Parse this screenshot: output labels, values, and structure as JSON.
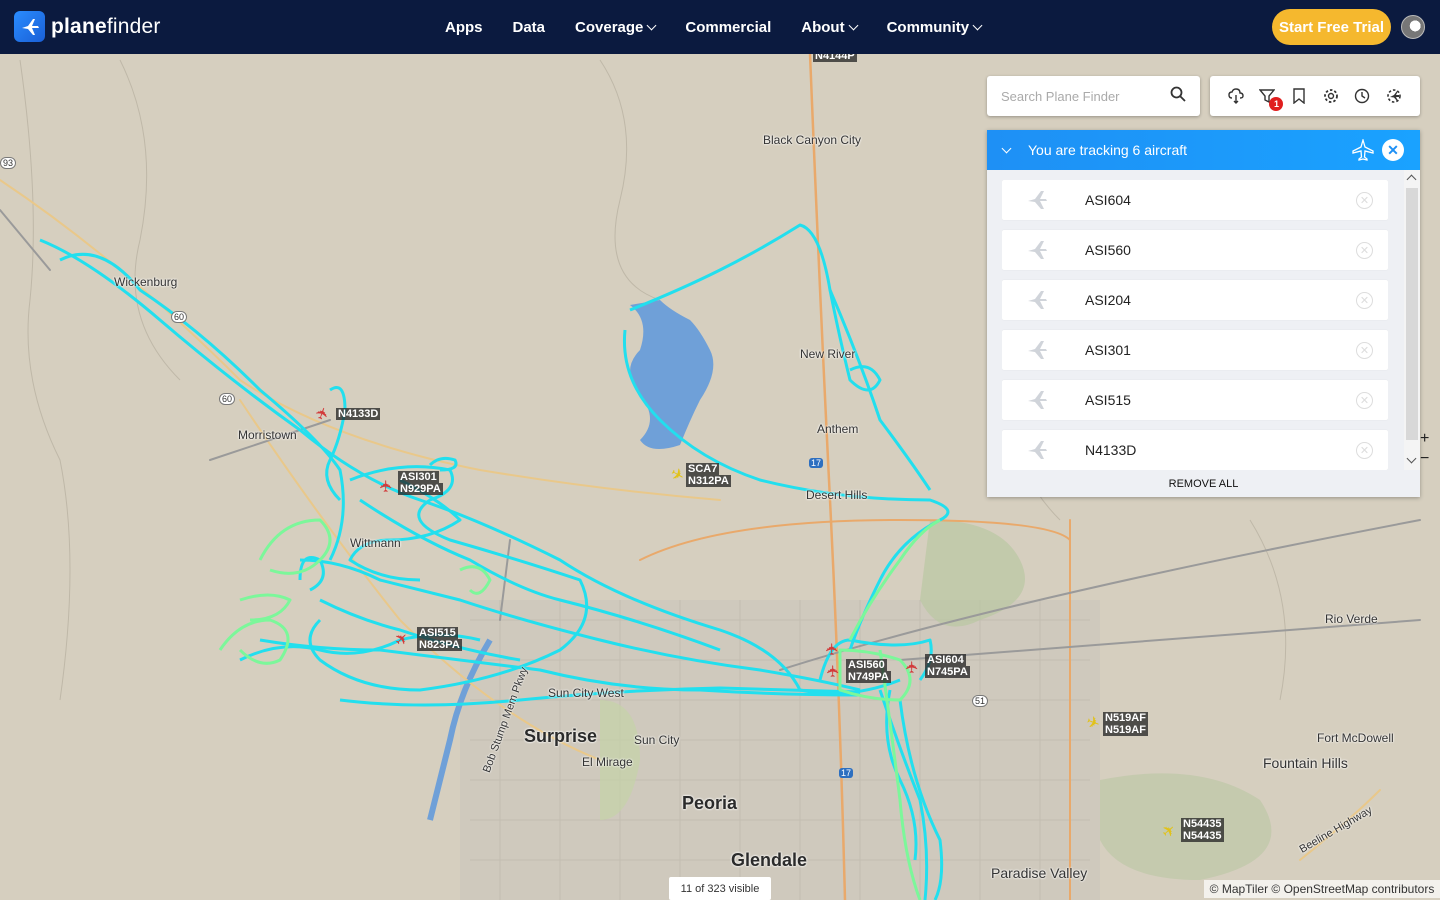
{
  "brand": {
    "name_a": "plane",
    "name_b": "finder"
  },
  "nav": [
    {
      "label": "Apps",
      "dropdown": false
    },
    {
      "label": "Data",
      "dropdown": false
    },
    {
      "label": "Coverage",
      "dropdown": true
    },
    {
      "label": "Commercial",
      "dropdown": false
    },
    {
      "label": "About",
      "dropdown": true
    },
    {
      "label": "Community",
      "dropdown": true
    }
  ],
  "cta_label": "Start Free Trial",
  "search": {
    "placeholder": "Search Plane Finder"
  },
  "toolbar": {
    "filter_badge": "1"
  },
  "tracking": {
    "title": "You are tracking 6 aircraft",
    "aircraft": [
      "ASI604",
      "ASI560",
      "ASI204",
      "ASI301",
      "ASI515",
      "N4133D"
    ],
    "remove_all": "REMOVE ALL"
  },
  "map": {
    "places": {
      "black_canyon": "Black Canyon City",
      "wickenburg": "Wickenburg",
      "new_river": "New River",
      "morristown": "Morristown",
      "anthem": "Anthem",
      "desert_hills": "Desert Hills",
      "wittmann": "Wittmann",
      "rio_verde": "Rio Verde",
      "surprise": "Surprise",
      "sun_city": "Sun City",
      "el_mirage": "El Mirage",
      "peoria": "Peoria",
      "fort_mcdowell": "Fort McDowell",
      "fountain_hills": "Fountain Hills",
      "glendale": "Glendale",
      "paradise_valley": "Paradise Valley",
      "beeline": "Beeline Highway",
      "bob_stump": "Bob Stump Mem Pkwy",
      "sun_city_west": "Sun City West"
    },
    "roads": {
      "r93": "93",
      "r60a": "60",
      "r60b": "60",
      "r17a": "17",
      "r17b": "17",
      "r51": "51"
    },
    "aircraft_labels": {
      "n4144p": "N4144P",
      "n4133d": "N4133D",
      "asi301": "ASI301",
      "n929pa": "N929PA",
      "sca7": "SCA7",
      "n312pa": "N312PA",
      "asi515": "ASI515",
      "n823pa": "N823PA",
      "asi560": "ASI560",
      "n749pa": "N749PA",
      "asi604": "ASI604",
      "n745pa": "N745PA",
      "n519af_a": "N519AF",
      "n519af_b": "N519AF",
      "n54435_a": "N54435",
      "n54435_b": "N54435"
    },
    "visible_count": "11 of 323 visible",
    "attribution": "© MapTiler © OpenStreetMap contributors",
    "zoom_in": "+",
    "zoom_out": "−"
  },
  "colors": {
    "header": "#0b1a3f",
    "accent": "#1e90f5",
    "cta": "#f5b82e",
    "track_cyan": "#22dfee",
    "track_green": "#7cf79a"
  }
}
